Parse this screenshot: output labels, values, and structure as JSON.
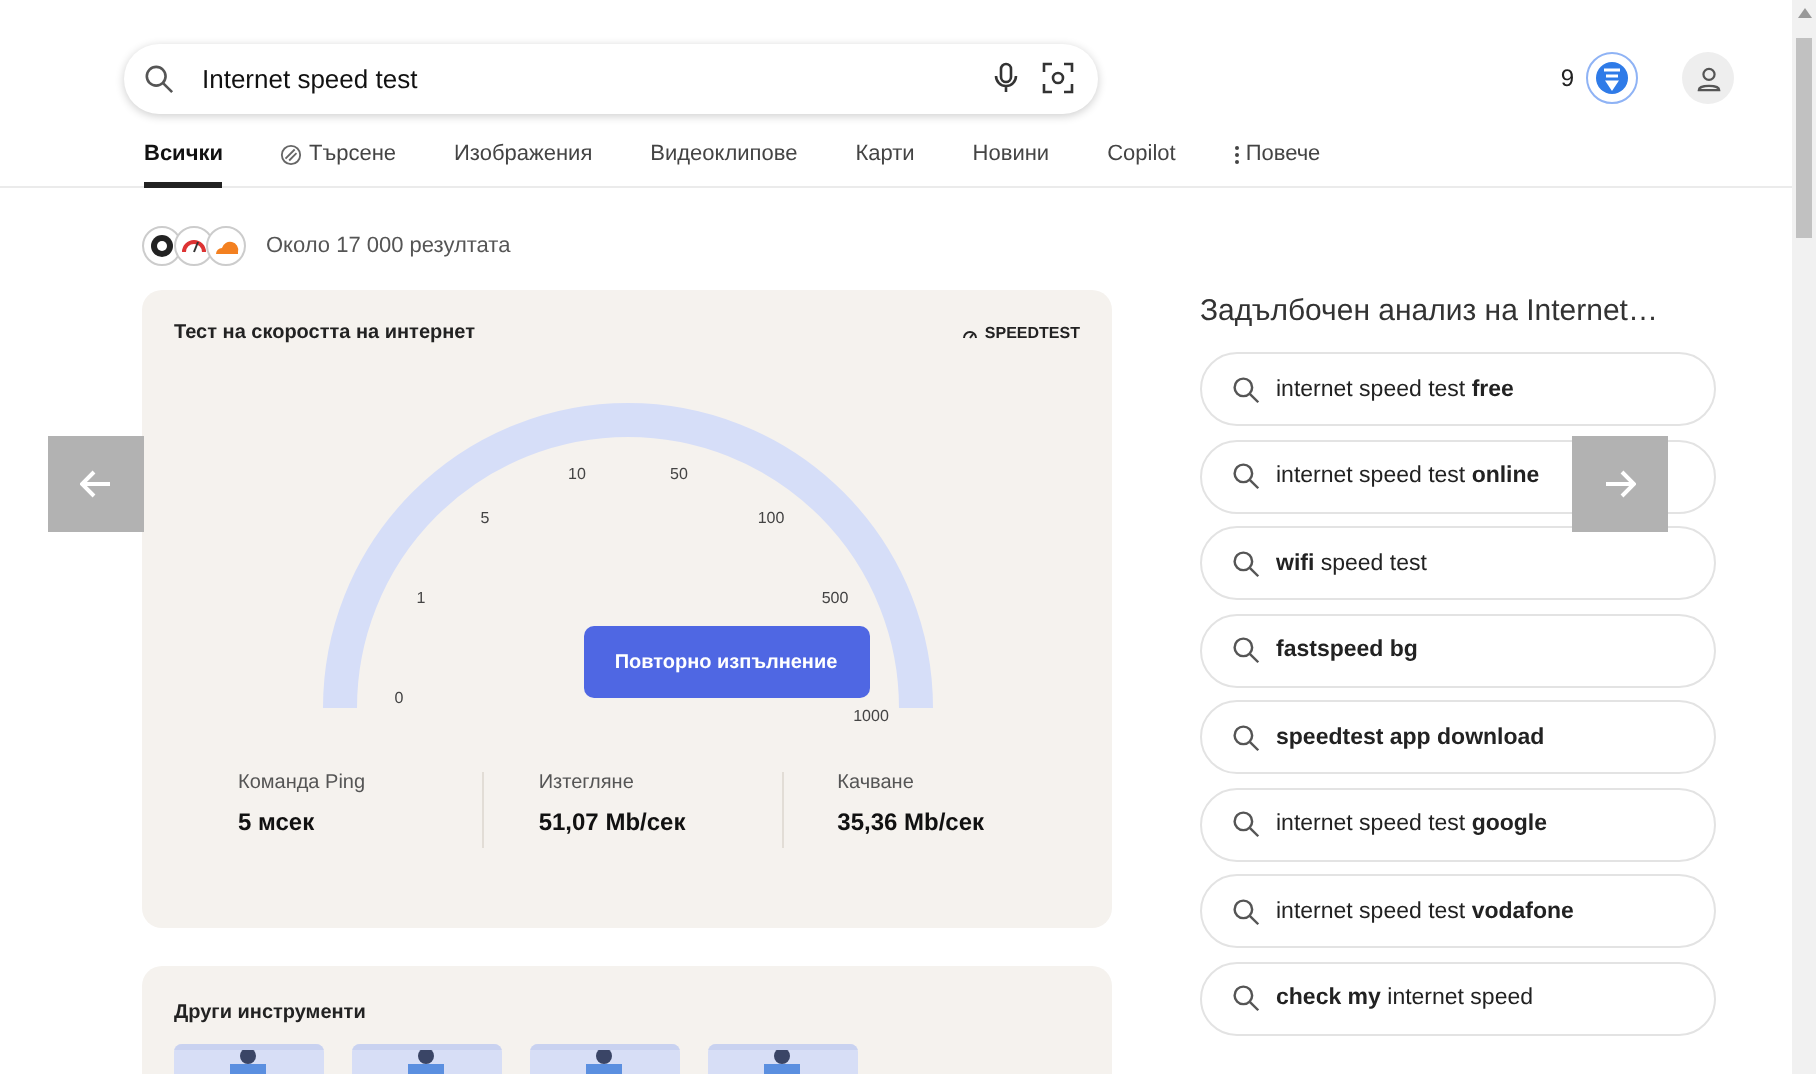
{
  "search": {
    "value": "Internet speed test"
  },
  "rewards": {
    "points": "9"
  },
  "tabs": [
    {
      "label": "Всички",
      "selected": true,
      "kind": "plain"
    },
    {
      "label": "Търсене",
      "selected": false,
      "kind": "copilot"
    },
    {
      "label": "Изображения",
      "selected": false,
      "kind": "plain"
    },
    {
      "label": "Видеоклипове",
      "selected": false,
      "kind": "plain"
    },
    {
      "label": "Карти",
      "selected": false,
      "kind": "plain"
    },
    {
      "label": "Новини",
      "selected": false,
      "kind": "plain"
    },
    {
      "label": "Copilot",
      "selected": false,
      "kind": "plain"
    },
    {
      "label": "Повече",
      "selected": false,
      "kind": "more"
    }
  ],
  "results_count": "Около 17 000 резултата",
  "speed_card": {
    "title": "Тест на скоростта на интернет",
    "brand": "SPEEDTEST",
    "gauge_labels": [
      "0",
      "1",
      "5",
      "10",
      "50",
      "100",
      "500",
      "1000"
    ],
    "button": "Повторно изпълнение",
    "stats": [
      {
        "label": "Команда Ping",
        "value": "5 мсек"
      },
      {
        "label": "Изтегляне",
        "value": "51,07 Mb/сек"
      },
      {
        "label": "Качване",
        "value": "35,36 Mb/сек"
      }
    ]
  },
  "tools_card": {
    "title": "Други инструменти"
  },
  "related": {
    "title": "Задълбочен анализ на Internet…",
    "items": [
      "internet speed test **free**",
      "internet speed test **online**",
      "**wifi** speed test",
      "**fastspeed bg**",
      "**speedtest app download**",
      "internet speed test **google**",
      "internet speed test **vodafone**",
      "**check my** internet speed"
    ]
  }
}
